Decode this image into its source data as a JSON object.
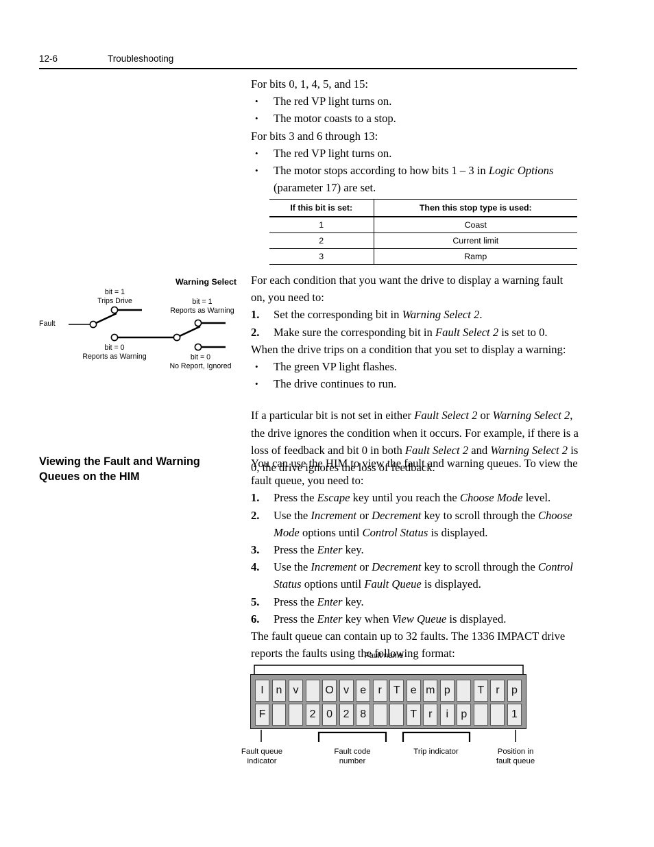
{
  "header": {
    "folio": "12-6",
    "chapter_title": "Troubleshooting"
  },
  "body": {
    "p_bits_0145_15": "For bits 0, 1, 4, 5, and 15:",
    "bullets_a": [
      "The red VP light turns on.",
      "The motor coasts to a stop."
    ],
    "p_bits_3_6_13": "For bits 3 and 6 through 13:",
    "bullets_b": [
      "The red VP light turns on."
    ],
    "bullet_b2_pre": "The motor stops according to how bits 1 – 3 in ",
    "bullet_b2_it": "Logic Options",
    "bullet_b2_post": " (parameter 17) are set.",
    "p_warning_intro": "For each condition that you want the drive to display a warning fault on, you need to:",
    "steps_warning": [
      {
        "num": "1.",
        "pre": "Set the corresponding bit in ",
        "it": "Warning Select 2",
        "post": "."
      },
      {
        "num": "2.",
        "pre": "Make sure the corresponding bit in ",
        "it": "Fault Select 2",
        "post": " is set to 0."
      }
    ],
    "p_when_trips": "When the drive trips on a condition that you set to display a warning:",
    "bullets_c": [
      "The green VP light flashes.",
      "The drive continues to run."
    ],
    "p_ignores_1_pre": "If a particular bit is not set in either ",
    "p_ignores_1_it1": "Fault Select 2",
    "p_ignores_1_mid1": " or ",
    "p_ignores_1_it2": "Warning Select 2",
    "p_ignores_1_mid2": ", the drive ignores the condition when it occurs. For example, if there is a loss of feedback and bit 0 in both ",
    "p_ignores_1_it3": "Fault Select 2",
    "p_ignores_1_mid3": " and ",
    "p_ignores_1_it4": "Warning Select 2",
    "p_ignores_1_post": " is 0, the drive ignores the loss of feedback.",
    "p_him_intro": "You can use the HIM to view the fault and warning queues. To view the fault queue, you need to:",
    "p_fault_queue_capacity": "The fault queue can contain up to 32 faults. The 1336 IMPACT drive reports the faults using the following format:"
  },
  "section_heading": {
    "line1": "Viewing the Fault and Warning",
    "line2": "Queues on the HIM"
  },
  "stop_table": {
    "headers": [
      "If this bit is set:",
      "Then this stop type is used:"
    ],
    "rows": [
      [
        "1",
        "Coast"
      ],
      [
        "2",
        "Current limit"
      ],
      [
        "3",
        "Ramp"
      ]
    ]
  },
  "him_steps": [
    {
      "num": "1.",
      "parts": [
        {
          "t": "Press the ",
          "i": false
        },
        {
          "t": "Escape",
          "i": true
        },
        {
          "t": " key until you reach the ",
          "i": false
        },
        {
          "t": "Choose Mode",
          "i": true
        },
        {
          "t": " level.",
          "i": false
        }
      ]
    },
    {
      "num": "2.",
      "parts": [
        {
          "t": "Use the ",
          "i": false
        },
        {
          "t": "Increment",
          "i": true
        },
        {
          "t": " or ",
          "i": false
        },
        {
          "t": "Decrement",
          "i": true
        },
        {
          "t": " key to scroll through the ",
          "i": false
        },
        {
          "t": "Choose Mode",
          "i": true
        },
        {
          "t": " options until ",
          "i": false
        },
        {
          "t": "Control Status",
          "i": true
        },
        {
          "t": " is displayed.",
          "i": false
        }
      ]
    },
    {
      "num": "3.",
      "parts": [
        {
          "t": "Press the ",
          "i": false
        },
        {
          "t": "Enter",
          "i": true
        },
        {
          "t": " key.",
          "i": false
        }
      ]
    },
    {
      "num": "4.",
      "parts": [
        {
          "t": "Use the ",
          "i": false
        },
        {
          "t": "Increment",
          "i": true
        },
        {
          "t": " or ",
          "i": false
        },
        {
          "t": "Decrement",
          "i": true
        },
        {
          "t": " key to scroll through the ",
          "i": false
        },
        {
          "t": "Control Status",
          "i": true
        },
        {
          "t": " options until ",
          "i": false
        },
        {
          "t": "Fault Queue",
          "i": true
        },
        {
          "t": " is displayed.",
          "i": false
        }
      ]
    },
    {
      "num": "5.",
      "parts": [
        {
          "t": "Press the ",
          "i": false
        },
        {
          "t": "Enter",
          "i": true
        },
        {
          "t": " key.",
          "i": false
        }
      ]
    },
    {
      "num": "6.",
      "parts": [
        {
          "t": "Press the ",
          "i": false
        },
        {
          "t": "Enter",
          "i": true
        },
        {
          "t": " key when ",
          "i": false
        },
        {
          "t": "View Queue",
          "i": true
        },
        {
          "t": " is displayed.",
          "i": false
        }
      ]
    }
  ],
  "switch_diagram": {
    "title": "Warning Select",
    "input_label": "Fault",
    "left_upper_bit": "bit = 1",
    "left_upper_desc": "Trips Drive",
    "left_lower_bit": "bit = 0",
    "left_lower_desc": "Reports as Warning",
    "right_upper_bit": "bit = 1",
    "right_upper_desc": "Reports as Warning",
    "right_lower_bit": "bit = 0",
    "right_lower_desc": "No Report, Ignored"
  },
  "lcd_figure": {
    "top_label": "Fault name",
    "row1": [
      "I",
      "n",
      "v",
      "",
      "O",
      "v",
      "e",
      "r",
      "T",
      "e",
      "m",
      "p",
      "",
      "T",
      "r",
      "p"
    ],
    "row2": [
      "F",
      "",
      "",
      "2",
      "0",
      "2",
      "8",
      "",
      "",
      "T",
      "r",
      "i",
      "p",
      "",
      "",
      "1"
    ],
    "callouts": [
      {
        "line1": "Fault queue",
        "line2": "indicator"
      },
      {
        "line1": "Fault code",
        "line2": "number"
      },
      {
        "line1": "Trip indicator",
        "line2": ""
      },
      {
        "line1": "Position in",
        "line2": "fault queue"
      }
    ],
    "panel_bg": "#9a9a9a",
    "cell_bg": "#ececec"
  }
}
